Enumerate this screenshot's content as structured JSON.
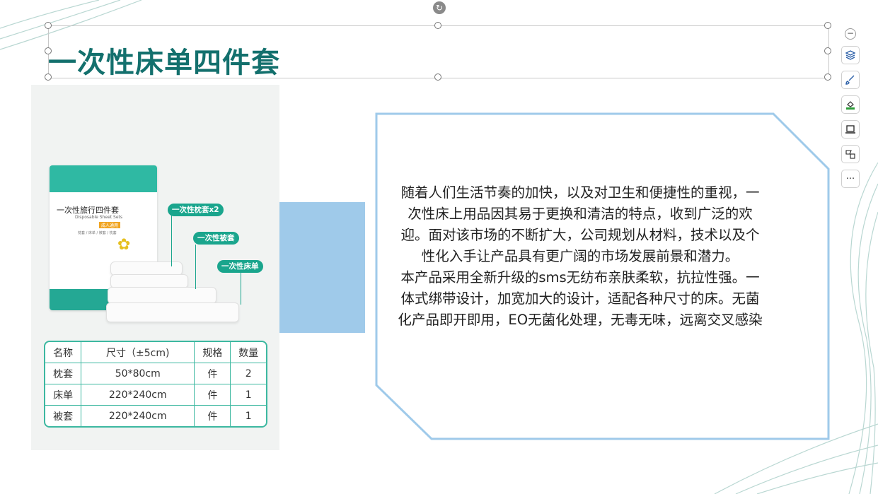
{
  "slide": {
    "title": "一次性床单四件套",
    "description": "随着人们生活节奏的加快，以及对卫生和便捷性的重视，一次性床上用品因其易于更换和清洁的特点，收到广泛的欢迎。面对该市场的不断扩大，公司规划从材料，技术以及个性化入手让产品具有更广阔的市场发展前景和潜力。\n本产品采用全新升级的sms无纺布亲肤柔软，抗拉性强。一体式绑带设计，加宽加大的设计，适配各种尺寸的床。无菌化产品即开即用，EO无菌化处理，无毒无味，远离交叉感染",
    "colors": {
      "title": "#13706d",
      "accent_blue": "#9fcaea",
      "frame": "#9fcaea",
      "teal": "#1aa58d"
    }
  },
  "product_image": {
    "package_name": "一次性旅行四件套",
    "package_en": "Disposable Sheet Sets",
    "package_tag": "成人通用",
    "package_sub": "枕套 / 床单 / 被套 / 枕套",
    "labels": [
      "一次性枕套x2",
      "一次性被套",
      "一次性床单"
    ],
    "table": {
      "headers": [
        "名称",
        "尺寸（±5cm)",
        "规格",
        "数量"
      ],
      "rows": [
        [
          "枕套",
          "50*80cm",
          "件",
          "2"
        ],
        [
          "床单",
          "220*240cm",
          "件",
          "1"
        ],
        [
          "被套",
          "220*240cm",
          "件",
          "1"
        ]
      ]
    }
  },
  "toolbar": {
    "items": [
      {
        "name": "collapse-button",
        "icon": "minus-icon"
      },
      {
        "name": "layers-button",
        "icon": "layers-icon"
      },
      {
        "name": "brush-button",
        "icon": "brush-icon"
      },
      {
        "name": "fill-button",
        "icon": "fill-icon"
      },
      {
        "name": "laptop-button",
        "icon": "laptop-icon"
      },
      {
        "name": "shape-button",
        "icon": "shape-icon"
      },
      {
        "name": "more-button",
        "icon": "more-icon"
      }
    ]
  }
}
